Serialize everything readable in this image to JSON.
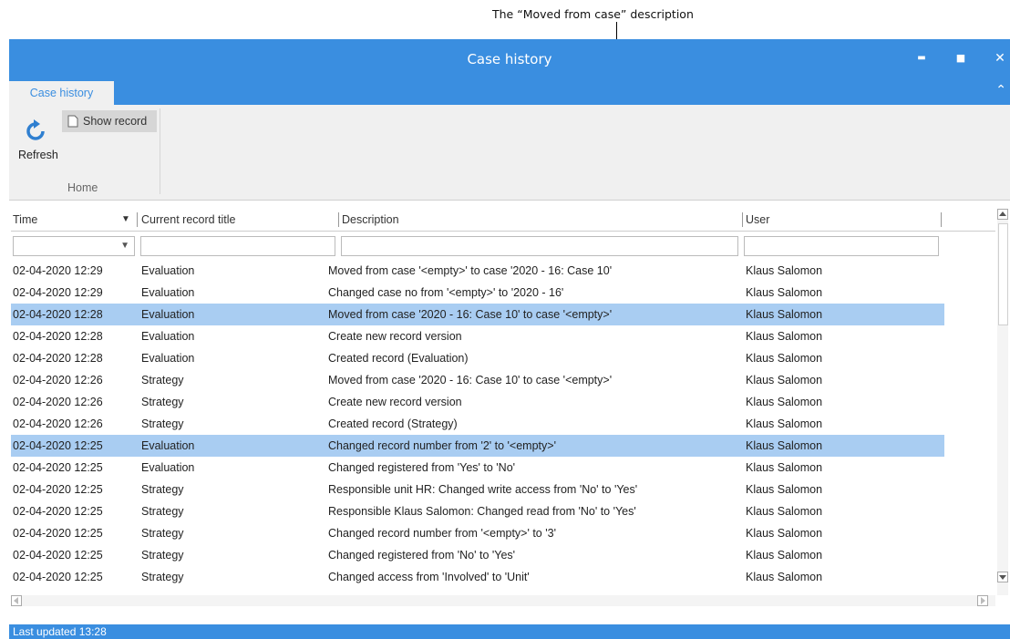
{
  "annotations": {
    "top_label": "The “Moved from case” description"
  },
  "window": {
    "title": "Case history",
    "minimize_glyph": "▬",
    "maximize_glyph": "■",
    "close_glyph": "✕",
    "collapse_glyph": "⌃"
  },
  "tabs": [
    {
      "label": "Case history",
      "active": true
    }
  ],
  "ribbon": {
    "refresh_label": "Refresh",
    "show_record_label": "Show record",
    "group_label": "Home"
  },
  "table": {
    "columns": [
      "Time",
      "Current record title",
      "Description",
      "User"
    ],
    "sort_glyph": "▼",
    "filter_dropdown_glyph": "▼",
    "rows": [
      {
        "time": "02-04-2020 12:29",
        "title": "Evaluation",
        "description": "Moved from case '<empty>' to case '2020 - 16: Case 10'",
        "user": "Klaus Salomon",
        "selected": false
      },
      {
        "time": "02-04-2020 12:29",
        "title": "Evaluation",
        "description": "Changed case no from '<empty>' to '2020 - 16'",
        "user": "Klaus Salomon",
        "selected": false
      },
      {
        "time": "02-04-2020 12:28",
        "title": "Evaluation",
        "description": "Moved from case '2020 - 16: Case 10' to case '<empty>'",
        "user": "Klaus Salomon",
        "selected": true
      },
      {
        "time": "02-04-2020 12:28",
        "title": "Evaluation",
        "description": "Create new record version",
        "user": "Klaus Salomon",
        "selected": false
      },
      {
        "time": "02-04-2020 12:28",
        "title": "Evaluation",
        "description": "Created record (Evaluation)",
        "user": "Klaus Salomon",
        "selected": false
      },
      {
        "time": "02-04-2020 12:26",
        "title": "Strategy",
        "description": "Moved from case '2020 - 16: Case 10' to case '<empty>'",
        "user": "Klaus Salomon",
        "selected": false
      },
      {
        "time": "02-04-2020 12:26",
        "title": "Strategy",
        "description": "Create new record version",
        "user": "Klaus Salomon",
        "selected": false
      },
      {
        "time": "02-04-2020 12:26",
        "title": "Strategy",
        "description": "Created record (Strategy)",
        "user": "Klaus Salomon",
        "selected": false
      },
      {
        "time": "02-04-2020 12:25",
        "title": "Evaluation",
        "description": "Changed record number from '2' to '<empty>'",
        "user": "Klaus Salomon",
        "selected": true
      },
      {
        "time": "02-04-2020 12:25",
        "title": "Evaluation",
        "description": "Changed registered from 'Yes' to 'No'",
        "user": "Klaus Salomon",
        "selected": false
      },
      {
        "time": "02-04-2020 12:25",
        "title": "Strategy",
        "description": "Responsible unit HR: Changed write access from 'No' to 'Yes'",
        "user": "Klaus Salomon",
        "selected": false
      },
      {
        "time": "02-04-2020 12:25",
        "title": "Strategy",
        "description": "Responsible Klaus Salomon: Changed read from 'No' to 'Yes'",
        "user": "Klaus Salomon",
        "selected": false
      },
      {
        "time": "02-04-2020 12:25",
        "title": "Strategy",
        "description": "Changed record number from '<empty>' to '3'",
        "user": "Klaus Salomon",
        "selected": false
      },
      {
        "time": "02-04-2020 12:25",
        "title": "Strategy",
        "description": "Changed registered from 'No' to 'Yes'",
        "user": "Klaus Salomon",
        "selected": false
      },
      {
        "time": "02-04-2020 12:25",
        "title": "Strategy",
        "description": "Changed access from 'Involved' to 'Unit'",
        "user": "Klaus Salomon",
        "selected": false
      }
    ]
  },
  "status": {
    "text": "Last updated 13:28"
  },
  "colors": {
    "accent": "#3a8ee0",
    "selected_row": "#a9cdf2",
    "ribbon_bg": "#f0f0f0"
  }
}
